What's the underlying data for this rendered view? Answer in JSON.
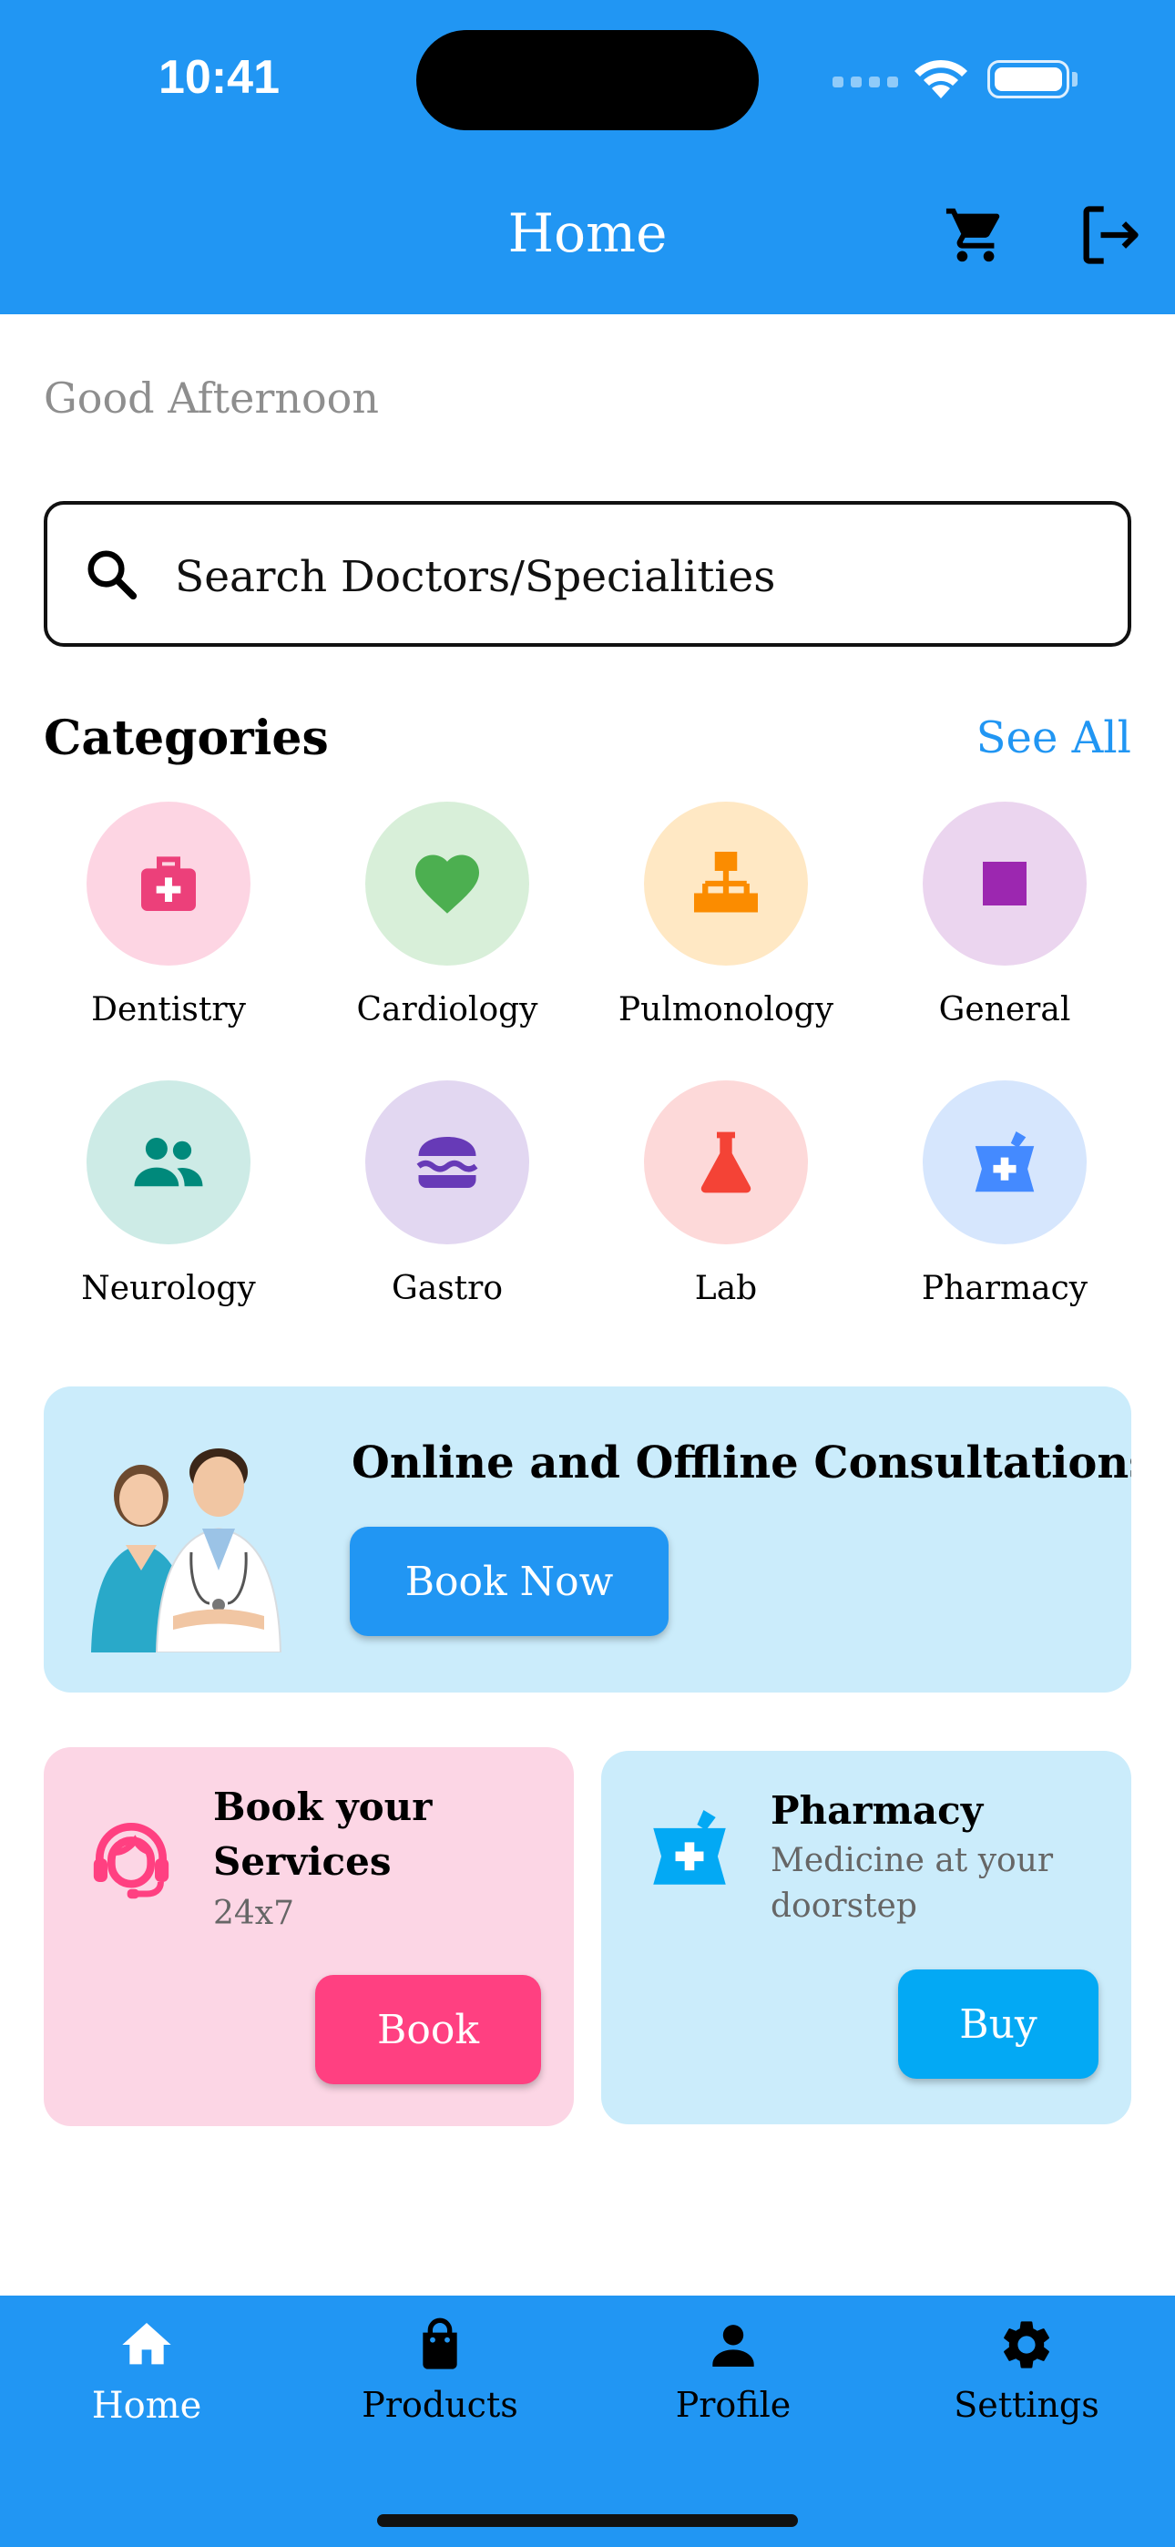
{
  "status_bar": {
    "time": "10:41"
  },
  "app_bar": {
    "title": "Home",
    "cart_icon": "cart-icon",
    "logout_icon": "logout-icon"
  },
  "greeting": "Good Afternoon",
  "search": {
    "placeholder": "Search Doctors/Specialities",
    "icon": "search-icon"
  },
  "categories": {
    "title": "Categories",
    "see_all": "See All",
    "items": [
      {
        "label": "Dentistry",
        "icon": "medkit-icon",
        "bg": "#FDD5E3",
        "color": "#EC407A"
      },
      {
        "label": "Cardiology",
        "icon": "heart-icon",
        "bg": "#D8EFD9",
        "color": "#4CAF50"
      },
      {
        "label": "Pulmonology",
        "icon": "sitemap-icon",
        "bg": "#FFE8C4",
        "color": "#FB8C00"
      },
      {
        "label": "General",
        "icon": "square-icon",
        "bg": "#EBD5EF",
        "color": "#9C27B0"
      },
      {
        "label": "Neurology",
        "icon": "people-icon",
        "bg": "#CDEBE6",
        "color": "#00897B"
      },
      {
        "label": "Gastro",
        "icon": "burger-icon",
        "bg": "#E2D7F1",
        "color": "#673AB7"
      },
      {
        "label": "Lab",
        "icon": "flask-icon",
        "bg": "#FDD9D9",
        "color": "#F44336"
      },
      {
        "label": "Pharmacy",
        "icon": "pharmacy-icon",
        "bg": "#D6E6FD",
        "color": "#448AFF"
      }
    ]
  },
  "banner": {
    "title": "Online and Offline Consultations",
    "button": "Book Now"
  },
  "services_card": {
    "title": "Book your Services",
    "subtitle": "24x7",
    "button": "Book",
    "icon": "support-agent-icon"
  },
  "pharmacy_card": {
    "title": "Pharmacy",
    "subtitle": "Medicine at your doorstep",
    "button": "Buy",
    "icon": "pharmacy-icon"
  },
  "bottom_nav": [
    {
      "label": "Home",
      "icon": "home-icon",
      "active": true
    },
    {
      "label": "Products",
      "icon": "bag-icon",
      "active": false
    },
    {
      "label": "Profile",
      "icon": "person-icon",
      "active": false
    },
    {
      "label": "Settings",
      "icon": "gear-icon",
      "active": false
    }
  ]
}
